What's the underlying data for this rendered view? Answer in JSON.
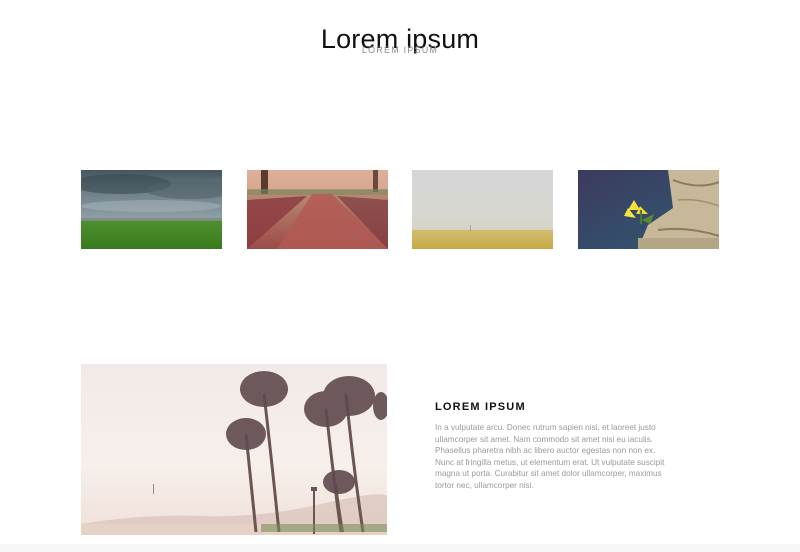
{
  "header": {
    "title": "Lorem ipsum",
    "subtitle": "LOREM IPSUM"
  },
  "gallery": {
    "items": [
      {
        "icon": "stormy-field-photo"
      },
      {
        "icon": "autumn-path-photo"
      },
      {
        "icon": "foggy-field-photo"
      },
      {
        "icon": "yellow-flower-photo"
      }
    ]
  },
  "feature": {
    "image_icon": "palm-trees-photo",
    "heading": "LOREM IPSUM",
    "body": "In a vulputate arcu. Donec rutrum sapien nisi, et laoreet justo ullamcorper sit amet. Nam commodo sit amet nisi eu iaculis. Phasellus pharetra nibh ac libero auctor egestas non non ex. Nunc at fringilla metus, ut elementum erat. Ut vulputate suscipit magna ut porta. Curabitur sit amet dolor ullamcorper, maximus tortor nec, ullamcorper nisi."
  }
}
